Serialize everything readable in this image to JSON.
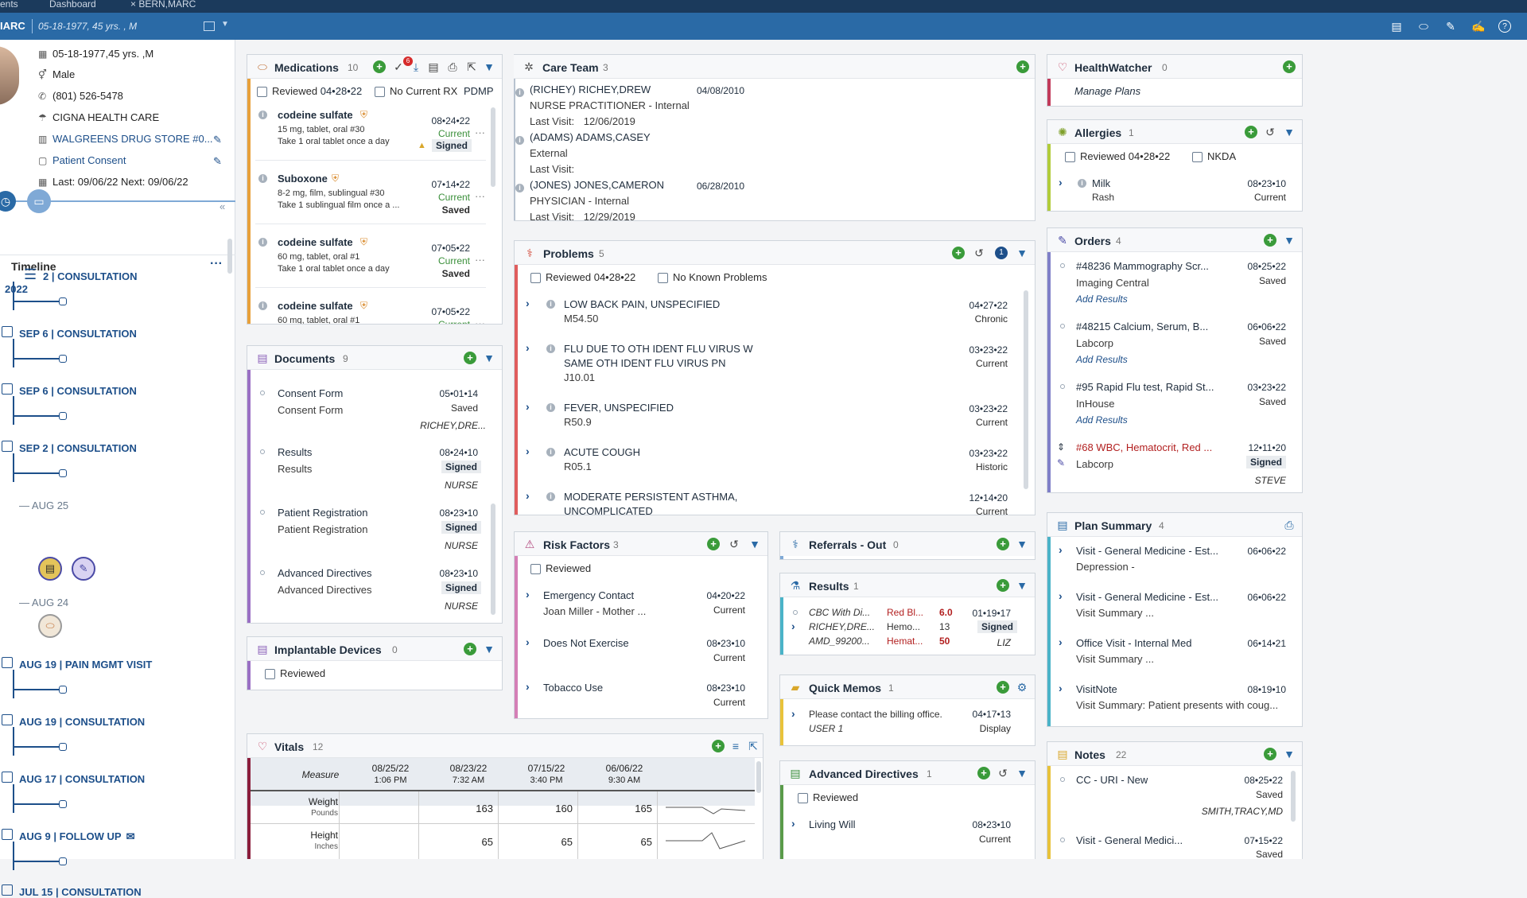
{
  "tabs": {
    "t1": "ents",
    "t2": "Dashboard",
    "t3": "BERN,MARC"
  },
  "patient": {
    "name": "IARC",
    "info": "05-18-1977,  45 yrs. ,  M"
  },
  "demo": {
    "dob": "05-18-1977,45 yrs. ,M",
    "sex": "Male",
    "phone": "(801) 526-5478",
    "insurance": "CIGNA HEALTH CARE",
    "pharmacy": "WALGREENS DRUG STORE #0...",
    "consent": "Patient Consent",
    "visits": "Last: 09/06/22  Next: 09/06/22"
  },
  "timeline": {
    "title": "Timeline",
    "year": "2022",
    "items": [
      "2 | CONSULTATION",
      "SEP 6 | CONSULTATION",
      "SEP 6 | CONSULTATION",
      "SEP 2 | CONSULTATION",
      "AUG 25",
      "AUG 24",
      "AUG 19 | PAIN MGMT VISIT",
      "AUG 19 | CONSULTATION",
      "AUG 17 | CONSULTATION",
      "AUG 9 | FOLLOW UP",
      "JUL 15 | CONSULTATION"
    ]
  },
  "medications": {
    "title": "Medications",
    "count": "10",
    "badge": "6",
    "reviewed": "Reviewed",
    "reviewed_date": "04•28•22",
    "no_rx": "No Current RX",
    "pdmp": "PDMP",
    "items": [
      {
        "name": "codeine sulfate",
        "d1": "15 mg, tablet, oral #30",
        "d2": "Take 1 oral tablet once a day",
        "date": "08•24•22",
        "state": "Current",
        "status": "Signed"
      },
      {
        "name": "Suboxone",
        "d1": "8-2 mg, film, sublingual #30",
        "d2": "Take 1 sublingual film once a ...",
        "date": "07•14•22",
        "state": "Current",
        "status": "Saved"
      },
      {
        "name": "codeine sulfate",
        "d1": "60 mg, tablet, oral #1",
        "d2": "Take 1 oral tablet once a day",
        "date": "07•05•22",
        "state": "Current",
        "status": "Saved"
      },
      {
        "name": "codeine sulfate",
        "d1": "60 mg, tablet, oral #1",
        "d2": "",
        "date": "07•05•22",
        "state": "Current",
        "status": ""
      }
    ]
  },
  "documents": {
    "title": "Documents",
    "count": "9",
    "items": [
      {
        "name": "Consent Form",
        "sub": "Consent Form",
        "date": "05•01•14",
        "status": "Saved",
        "by": "RICHEY,DRE..."
      },
      {
        "name": "Results",
        "sub": "Results",
        "date": "08•24•10",
        "status": "Signed",
        "by": "NURSE"
      },
      {
        "name": "Patient Registration",
        "sub": "Patient Registration",
        "date": "08•23•10",
        "status": "Signed",
        "by": "NURSE"
      },
      {
        "name": "Advanced Directives",
        "sub": "Advanced Directives",
        "date": "08•23•10",
        "status": "Signed",
        "by": "NURSE"
      }
    ]
  },
  "implant": {
    "title": "Implantable Devices",
    "count": "0",
    "reviewed": "Reviewed"
  },
  "vitals": {
    "title": "Vitals",
    "count": "12",
    "measure": "Measure",
    "cols": [
      {
        "d": "08/25/22",
        "t": "1:06 PM"
      },
      {
        "d": "08/23/22",
        "t": "7:32 AM"
      },
      {
        "d": "07/15/22",
        "t": "3:40 PM"
      },
      {
        "d": "06/06/22",
        "t": "9:30 AM"
      }
    ],
    "rows": [
      {
        "name": "Weight",
        "unit": "Pounds",
        "vals": [
          "",
          "163",
          "160",
          "165"
        ]
      },
      {
        "name": "Height",
        "unit": "Inches",
        "vals": [
          "",
          "65",
          "65",
          "65"
        ]
      }
    ]
  },
  "care": {
    "title": "Care Team",
    "count": "3",
    "items": [
      {
        "name": "(RICHEY) RICHEY,DREW",
        "date": "04/08/2010",
        "role": "NURSE PRACTITIONER - Internal",
        "lv": "Last Visit:",
        "lvd": "12/06/2019"
      },
      {
        "name": "(ADAMS) ADAMS,CASEY",
        "date": "",
        "role": "External",
        "lv": "Last Visit:",
        "lvd": ""
      },
      {
        "name": "(JONES) JONES,CAMERON",
        "date": "06/28/2010",
        "role": "PHYSICIAN - Internal",
        "lv": "Last Visit:",
        "lvd": "12/29/2019"
      }
    ]
  },
  "problems": {
    "title": "Problems",
    "count": "5",
    "reviewed": "Reviewed",
    "reviewed_date": "04•28•22",
    "nkp": "No Known Problems",
    "badge": "1",
    "items": [
      {
        "l1": "LOW BACK PAIN, UNSPECIFIED",
        "l2": "M54.50",
        "l3": "",
        "date": "04•27•22",
        "status": "Chronic"
      },
      {
        "l1": "FLU DUE TO OTH IDENT FLU VIRUS W",
        "l2": "SAME OTH IDENT FLU VIRUS PN",
        "l3": "J10.01",
        "date": "03•23•22",
        "status": "Current"
      },
      {
        "l1": "FEVER, UNSPECIFIED",
        "l2": "R50.9",
        "l3": "",
        "date": "03•23•22",
        "status": "Current"
      },
      {
        "l1": "ACUTE COUGH",
        "l2": "R05.1",
        "l3": "",
        "date": "03•23•22",
        "status": "Historic"
      },
      {
        "l1": "MODERATE PERSISTENT ASTHMA,",
        "l2": "UNCOMPLICATED",
        "l3": "",
        "date": "12•14•20",
        "status": "Current"
      }
    ]
  },
  "risk": {
    "title": "Risk Factors",
    "count": "3",
    "reviewed": "Reviewed",
    "items": [
      {
        "l1": "Emergency Contact",
        "l2": "Joan Miller - Mother  ...",
        "date": "04•20•22",
        "status": "Current"
      },
      {
        "l1": "Does Not Exercise",
        "l2": "",
        "date": "08•23•10",
        "status": "Current"
      },
      {
        "l1": "Tobacco Use",
        "l2": "",
        "date": "08•23•10",
        "status": "Current"
      }
    ]
  },
  "referrals": {
    "title": "Referrals - Out",
    "count": "0"
  },
  "results": {
    "title": "Results",
    "count": "1",
    "c1": [
      "CBC With Di...",
      "RICHEY,DRE...",
      "AMD_99200..."
    ],
    "c2": [
      "Red Bl...",
      "Hemo...",
      "Hemat..."
    ],
    "c3": [
      "6.0",
      "13",
      "50"
    ],
    "date": "01•19•17",
    "status": "Signed",
    "by": "LIZ"
  },
  "memos": {
    "title": "Quick Memos",
    "count": "1",
    "l1": "Please contact the billing office.",
    "l2": "USER 1",
    "date": "04•17•13",
    "status": "Display"
  },
  "advdir": {
    "title": "Advanced Directives",
    "count": "1",
    "reviewed": "Reviewed",
    "item": "Living Will",
    "date": "08•23•10",
    "status": "Current"
  },
  "health": {
    "title": "HealthWatcher",
    "count": "0",
    "link": "Manage Plans"
  },
  "allergies": {
    "title": "Allergies",
    "count": "1",
    "reviewed": "Reviewed",
    "reviewed_date": "04•28•22",
    "nkda": "NKDA",
    "item": "Milk",
    "sub": "Rash",
    "date": "08•23•10",
    "status": "Current"
  },
  "orders": {
    "title": "Orders",
    "count": "4",
    "add": "Add Results",
    "items": [
      {
        "l1": "#48236 Mammography Scr...",
        "l2": "Imaging Central",
        "date": "08•25•22",
        "status": "Saved"
      },
      {
        "l1": "#48215 Calcium, Serum, B...",
        "l2": "Labcorp",
        "date": "06•06•22",
        "status": "Saved"
      },
      {
        "l1": "#95 Rapid Flu test, Rapid St...",
        "l2": "InHouse",
        "date": "03•23•22",
        "status": "Saved"
      },
      {
        "l1": "#68 WBC, Hematocrit, Red ...",
        "l2": "Labcorp",
        "date": "12•11•20",
        "status": "Signed",
        "by": "STEVE"
      }
    ]
  },
  "plan": {
    "title": "Plan Summary",
    "count": "4",
    "items": [
      {
        "l1": "Visit - General Medicine - Est...",
        "l2": "Depression -",
        "date": "06•06•22"
      },
      {
        "l1": "Visit - General Medicine - Est...",
        "l2": "Visit Summary  ...",
        "date": "06•06•22"
      },
      {
        "l1": "Office Visit - Internal Med",
        "l2": "Visit Summary  ...",
        "date": "06•14•21"
      },
      {
        "l1": "VisitNote",
        "l2": "Visit Summary: Patient presents with coug...",
        "date": "08•19•10"
      }
    ]
  },
  "notes": {
    "title": "Notes",
    "count": "22",
    "items": [
      {
        "l1": "CC - URI - New",
        "date": "08•25•22",
        "status": "Saved",
        "by": "SMITH,TRACY,MD"
      },
      {
        "l1": "Visit - General Medici...",
        "date": "07•15•22",
        "status": "Saved",
        "by": ""
      }
    ]
  }
}
